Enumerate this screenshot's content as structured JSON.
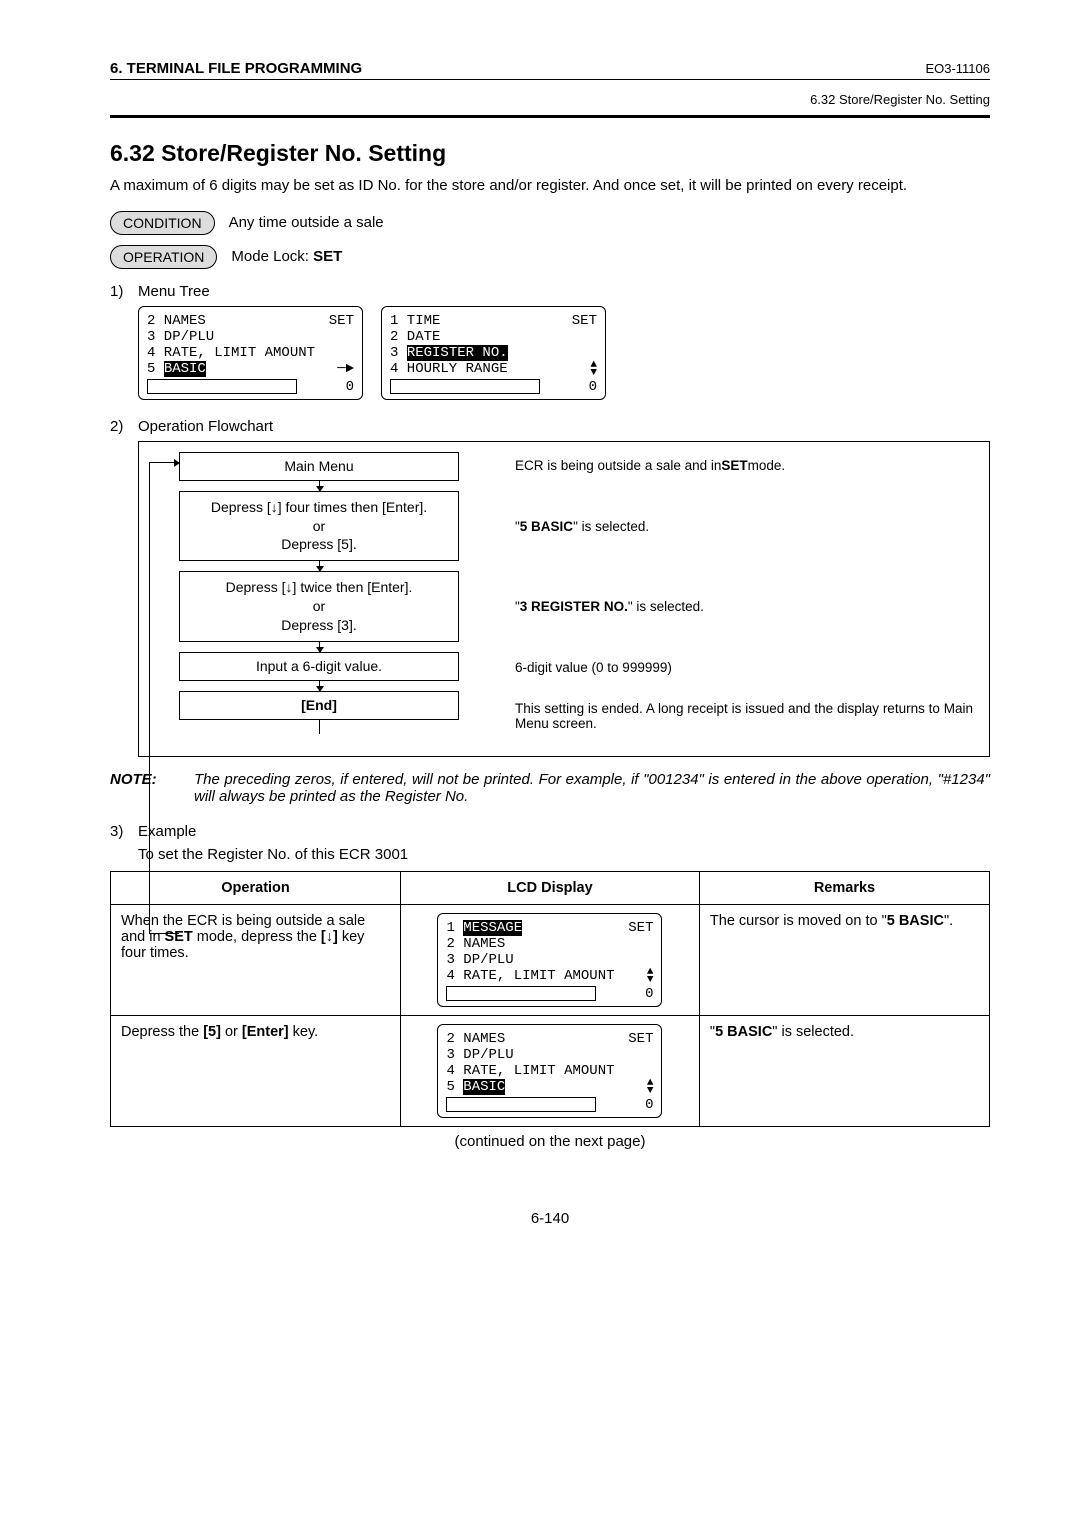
{
  "header": {
    "left": "6. TERMINAL FILE PROGRAMMING",
    "right": "EO3-11106",
    "sub": "6.32 Store/Register No. Setting"
  },
  "title": "6.32   Store/Register No. Setting",
  "intro": "A maximum of 6 digits may be set as ID No. for the store and/or register.  And once set, it will be printed on every receipt.",
  "condition": {
    "label": "CONDITION",
    "text": "Any time outside a sale"
  },
  "operation_pill": {
    "label": "OPERATION",
    "text_prefix": "Mode Lock: ",
    "text_bold": "SET"
  },
  "sec1": {
    "num": "1)",
    "title": "Menu Tree"
  },
  "menu_left": {
    "l1": "2 NAMES",
    "r1": "SET",
    "l2": "3 DP/PLU",
    "l3": "4 RATE, LIMIT AMOUNT",
    "l4_pre": "5 ",
    "l4_hl": "BASIC",
    "bottom_right": "0"
  },
  "menu_right": {
    "l1": "1 TIME",
    "r1": "SET",
    "l2": "2 DATE",
    "l3_pre": "3 ",
    "l3_hl": "REGISTER NO.",
    "l4": "4 HOURLY RANGE",
    "bottom_right": "0"
  },
  "sec2": {
    "num": "2)",
    "title": "Operation Flowchart"
  },
  "flow": {
    "b1": "Main Menu",
    "b2a": "Depress [↓] four times then [Enter].",
    "b2b": "or",
    "b2c": "Depress [5].",
    "b3a": "Depress [↓] twice then [Enter].",
    "b3b": "or",
    "b3c": "Depress [3].",
    "b4": "Input a 6-digit value.",
    "b5": "[End]",
    "r1_pre": "ECR is being outside a sale and in ",
    "r1_bold": "SET",
    "r1_post": " mode.",
    "r2_pre": "\"",
    "r2_bold": "5 BASIC",
    "r2_post": "\" is selected.",
    "r3_pre": "\"",
    "r3_bold": "3 REGISTER NO.",
    "r3_post": "\" is selected.",
    "r4": "6-digit value (0 to 999999)",
    "r5": "This setting is ended.  A long receipt is issued and the display returns to Main Menu screen."
  },
  "note": {
    "label": "NOTE:",
    "text": "The preceding zeros, if entered, will not be printed. For example, if \"001234\" is entered in the above operation, \"#1234\" will always be printed as the Register No."
  },
  "sec3": {
    "num": "3)",
    "title": "Example",
    "sub": "To set the Register No. of this ECR 3001"
  },
  "table": {
    "h1": "Operation",
    "h2": "LCD Display",
    "h3": "Remarks",
    "row1": {
      "op_pre": "When the ECR is being outside a sale and in ",
      "op_b1": "SET",
      "op_mid": " mode, depress the ",
      "op_b2": "[↓]",
      "op_post": " key four times.",
      "lcd": {
        "l1_pre": "1 ",
        "l1_hl": "MESSAGE",
        "r1": "SET",
        "l2": "2 NAMES",
        "l3": "3 DP/PLU",
        "l4": "4 RATE, LIMIT AMOUNT",
        "bottom_right": "0"
      },
      "rem_pre": "The cursor is moved on to \"",
      "rem_bold": "5 BASIC",
      "rem_post": "\"."
    },
    "row2": {
      "op_pre": "Depress the ",
      "op_b1": "[5]",
      "op_mid": " or ",
      "op_b2": "[Enter]",
      "op_post": " key.",
      "lcd": {
        "l1": "2 NAMES",
        "r1": "SET",
        "l2": "3 DP/PLU",
        "l3": "4 RATE, LIMIT AMOUNT",
        "l4_pre": "5 ",
        "l4_hl": "BASIC",
        "bottom_right": "0"
      },
      "rem_pre": "\"",
      "rem_bold": "5 BASIC",
      "rem_post": "\" is selected."
    }
  },
  "continued": "(continued on the next page)",
  "page_num": "6-140"
}
